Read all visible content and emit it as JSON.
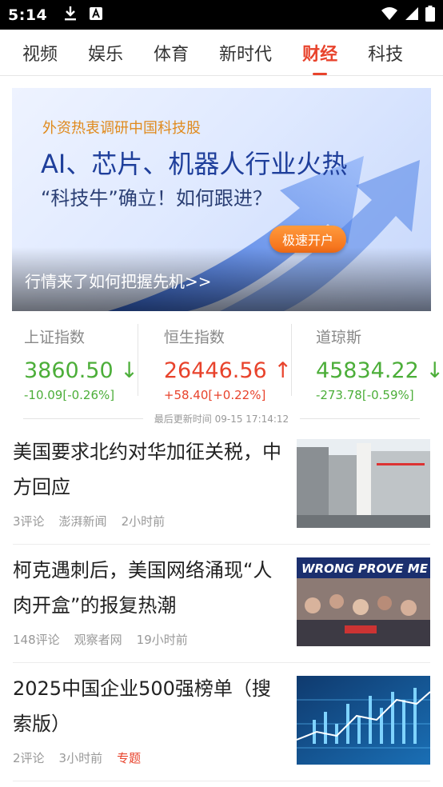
{
  "status_bar": {
    "time": "5:14"
  },
  "tabs": [
    "视频",
    "娱乐",
    "体育",
    "新时代",
    "财经",
    "科技"
  ],
  "active_tab": "财经",
  "banner": {
    "subtitle": "外资热衷调研中国科技股",
    "title": "AI、芯片、机器人行业火热",
    "title2": "“科技牛”确立！如何跟进？",
    "button": "极速开户",
    "caption": "行情来了如何把握先机>>"
  },
  "market": [
    {
      "name": "上证指数",
      "value": "3860.50",
      "arrow": "↓",
      "change": "-10.09[-0.26%]",
      "color": "#4cae39"
    },
    {
      "name": "恒生指数",
      "value": "26446.56",
      "arrow": "↑",
      "change": "+58.40[+0.22%]",
      "color": "#e8432c"
    },
    {
      "name": "道琼斯",
      "value": "45834.22",
      "arrow": "↓",
      "change": "-273.78[-0.59%]",
      "color": "#4cae39"
    }
  ],
  "updated": "最后更新时间 09-15 17:14:12",
  "news": [
    {
      "title": "美国要求北约对华加征关税，中方回应",
      "comments": "3评论",
      "source": "澎湃新闻",
      "time": "2小时前",
      "image": "foreign-ministry-building"
    },
    {
      "title": "柯克遇刺后，美国网络涌现“人肉开盒”的报复热潮",
      "comments": "148评论",
      "source": "观察者网",
      "time": "19小时前",
      "image": "crowd-with-banner",
      "banner_text": "WRONG PROVE ME"
    },
    {
      "title": "2025中国企业500强榜单（搜索版）",
      "comments": "2评论",
      "source": "",
      "time": "3小时前",
      "tag": "专题",
      "image": "finance-chart"
    }
  ]
}
